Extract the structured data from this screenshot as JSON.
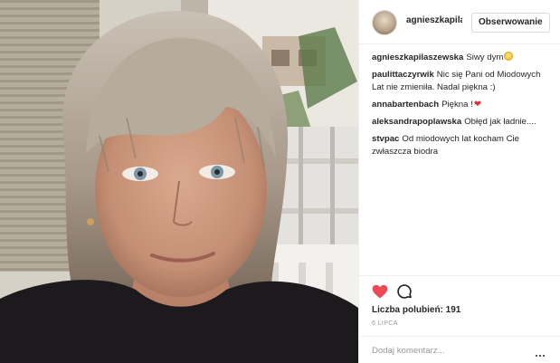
{
  "header": {
    "username": "agnieszkapilas",
    "follow_label": "Obserwowanie"
  },
  "comments": [
    {
      "user": "agnieszkapilaszewska",
      "text": "Siwy dym",
      "emoji": "grinning-face-emoji"
    },
    {
      "user": "paulittaczyrwik",
      "text": "Nic się Pani od Miodowych Lat nie zmieniła. Nadal piękna :)"
    },
    {
      "user": "annabartenbach",
      "text": "Piękna !",
      "emoji": "red-heart-emoji"
    },
    {
      "user": "aleksandrapoplawska",
      "text": "Obłęd jak ładnie...."
    },
    {
      "user": "stvpac",
      "text": "Od miodowych lat kocham Cie zwłaszcza biodra"
    }
  ],
  "actions": {
    "like_icon": "heart-icon",
    "like_color": "#ed4956",
    "comment_icon": "speech-bubble-icon",
    "likes_label": "Liczba polubień: 191",
    "date": "6 LIPCA"
  },
  "add_comment": {
    "placeholder": "Dodaj komentarz...",
    "more_icon": "ellipsis-icon"
  },
  "photo": {
    "icon": "photo"
  }
}
